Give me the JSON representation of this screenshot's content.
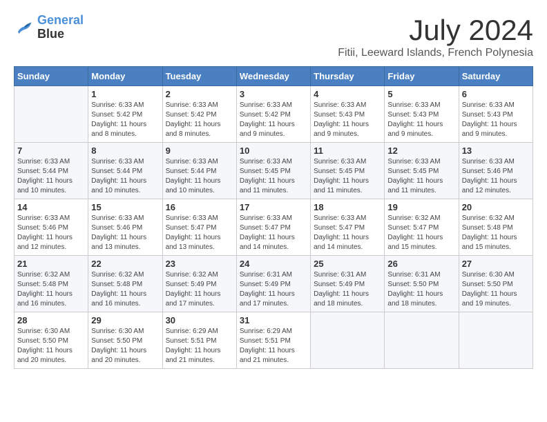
{
  "header": {
    "logo_line1": "General",
    "logo_line2": "Blue",
    "month": "July 2024",
    "location": "Fitii, Leeward Islands, French Polynesia"
  },
  "weekdays": [
    "Sunday",
    "Monday",
    "Tuesday",
    "Wednesday",
    "Thursday",
    "Friday",
    "Saturday"
  ],
  "weeks": [
    [
      {
        "day": "",
        "info": ""
      },
      {
        "day": "1",
        "info": "Sunrise: 6:33 AM\nSunset: 5:42 PM\nDaylight: 11 hours\nand 8 minutes."
      },
      {
        "day": "2",
        "info": "Sunrise: 6:33 AM\nSunset: 5:42 PM\nDaylight: 11 hours\nand 8 minutes."
      },
      {
        "day": "3",
        "info": "Sunrise: 6:33 AM\nSunset: 5:42 PM\nDaylight: 11 hours\nand 9 minutes."
      },
      {
        "day": "4",
        "info": "Sunrise: 6:33 AM\nSunset: 5:43 PM\nDaylight: 11 hours\nand 9 minutes."
      },
      {
        "day": "5",
        "info": "Sunrise: 6:33 AM\nSunset: 5:43 PM\nDaylight: 11 hours\nand 9 minutes."
      },
      {
        "day": "6",
        "info": "Sunrise: 6:33 AM\nSunset: 5:43 PM\nDaylight: 11 hours\nand 9 minutes."
      }
    ],
    [
      {
        "day": "7",
        "info": "Sunrise: 6:33 AM\nSunset: 5:44 PM\nDaylight: 11 hours\nand 10 minutes."
      },
      {
        "day": "8",
        "info": "Sunrise: 6:33 AM\nSunset: 5:44 PM\nDaylight: 11 hours\nand 10 minutes."
      },
      {
        "day": "9",
        "info": "Sunrise: 6:33 AM\nSunset: 5:44 PM\nDaylight: 11 hours\nand 10 minutes."
      },
      {
        "day": "10",
        "info": "Sunrise: 6:33 AM\nSunset: 5:45 PM\nDaylight: 11 hours\nand 11 minutes."
      },
      {
        "day": "11",
        "info": "Sunrise: 6:33 AM\nSunset: 5:45 PM\nDaylight: 11 hours\nand 11 minutes."
      },
      {
        "day": "12",
        "info": "Sunrise: 6:33 AM\nSunset: 5:45 PM\nDaylight: 11 hours\nand 11 minutes."
      },
      {
        "day": "13",
        "info": "Sunrise: 6:33 AM\nSunset: 5:46 PM\nDaylight: 11 hours\nand 12 minutes."
      }
    ],
    [
      {
        "day": "14",
        "info": "Sunrise: 6:33 AM\nSunset: 5:46 PM\nDaylight: 11 hours\nand 12 minutes."
      },
      {
        "day": "15",
        "info": "Sunrise: 6:33 AM\nSunset: 5:46 PM\nDaylight: 11 hours\nand 13 minutes."
      },
      {
        "day": "16",
        "info": "Sunrise: 6:33 AM\nSunset: 5:47 PM\nDaylight: 11 hours\nand 13 minutes."
      },
      {
        "day": "17",
        "info": "Sunrise: 6:33 AM\nSunset: 5:47 PM\nDaylight: 11 hours\nand 14 minutes."
      },
      {
        "day": "18",
        "info": "Sunrise: 6:33 AM\nSunset: 5:47 PM\nDaylight: 11 hours\nand 14 minutes."
      },
      {
        "day": "19",
        "info": "Sunrise: 6:32 AM\nSunset: 5:47 PM\nDaylight: 11 hours\nand 15 minutes."
      },
      {
        "day": "20",
        "info": "Sunrise: 6:32 AM\nSunset: 5:48 PM\nDaylight: 11 hours\nand 15 minutes."
      }
    ],
    [
      {
        "day": "21",
        "info": "Sunrise: 6:32 AM\nSunset: 5:48 PM\nDaylight: 11 hours\nand 16 minutes."
      },
      {
        "day": "22",
        "info": "Sunrise: 6:32 AM\nSunset: 5:48 PM\nDaylight: 11 hours\nand 16 minutes."
      },
      {
        "day": "23",
        "info": "Sunrise: 6:32 AM\nSunset: 5:49 PM\nDaylight: 11 hours\nand 17 minutes."
      },
      {
        "day": "24",
        "info": "Sunrise: 6:31 AM\nSunset: 5:49 PM\nDaylight: 11 hours\nand 17 minutes."
      },
      {
        "day": "25",
        "info": "Sunrise: 6:31 AM\nSunset: 5:49 PM\nDaylight: 11 hours\nand 18 minutes."
      },
      {
        "day": "26",
        "info": "Sunrise: 6:31 AM\nSunset: 5:50 PM\nDaylight: 11 hours\nand 18 minutes."
      },
      {
        "day": "27",
        "info": "Sunrise: 6:30 AM\nSunset: 5:50 PM\nDaylight: 11 hours\nand 19 minutes."
      }
    ],
    [
      {
        "day": "28",
        "info": "Sunrise: 6:30 AM\nSunset: 5:50 PM\nDaylight: 11 hours\nand 20 minutes."
      },
      {
        "day": "29",
        "info": "Sunrise: 6:30 AM\nSunset: 5:50 PM\nDaylight: 11 hours\nand 20 minutes."
      },
      {
        "day": "30",
        "info": "Sunrise: 6:29 AM\nSunset: 5:51 PM\nDaylight: 11 hours\nand 21 minutes."
      },
      {
        "day": "31",
        "info": "Sunrise: 6:29 AM\nSunset: 5:51 PM\nDaylight: 11 hours\nand 21 minutes."
      },
      {
        "day": "",
        "info": ""
      },
      {
        "day": "",
        "info": ""
      },
      {
        "day": "",
        "info": ""
      }
    ]
  ]
}
